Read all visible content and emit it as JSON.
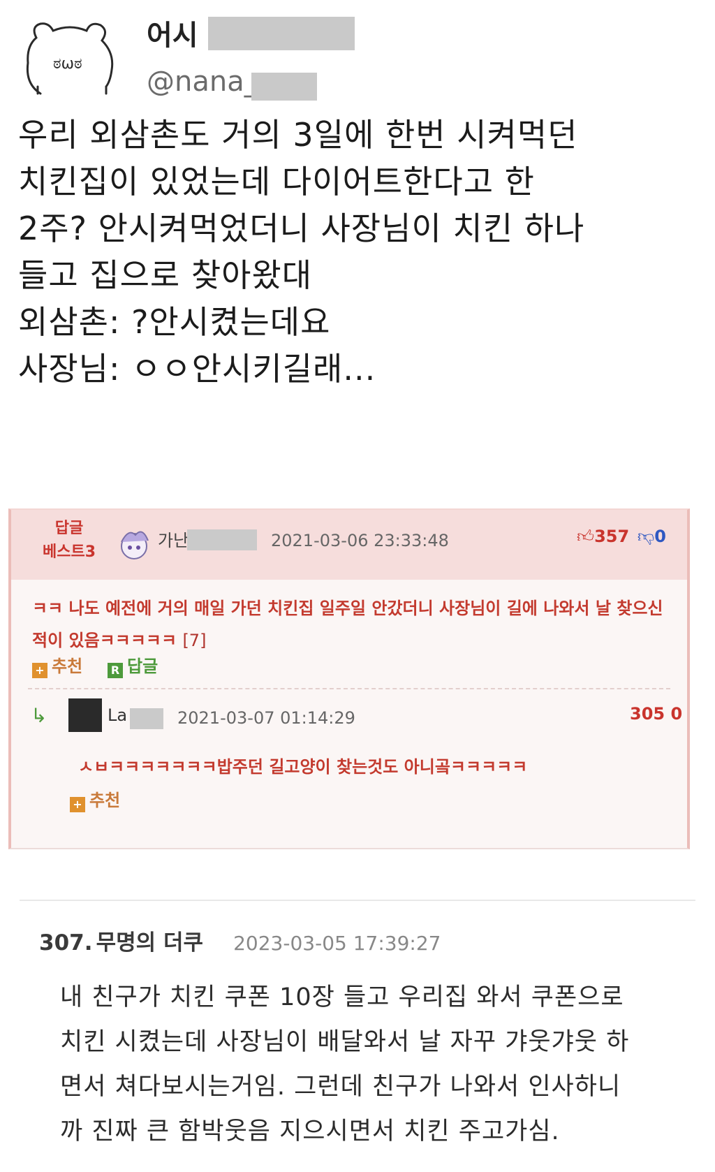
{
  "tweet": {
    "name_visible": "어시",
    "handle_visible": "@nana_",
    "lines": [
      "우리 외삼촌도 거의 3일에 한번 시켜먹던",
      "치킨집이 있었는데 다이어트한다고 한",
      "2주? 안시켜먹었더니 사장님이 치킨 하나",
      "들고 집으로 찾아왔대",
      "외삼촌: ?안시켰는데요",
      "사장님: ㅇㅇ안시키길래..."
    ]
  },
  "comment": {
    "badge_line1": "답글",
    "badge_line2": "베스트3",
    "user_visible": "가난",
    "date": "2021-03-06 23:33:48",
    "upvotes": "357",
    "downvotes": "0",
    "body": "ㅋㅋ 나도 예전에 거의 매일 가던 치킨집 일주일 안갔더니 사장님이 길에 나와서 날 찾으신적이 있음ㅋㅋㅋㅋㅋ",
    "reply_count": "[7]",
    "recommend_label": "추천",
    "reply_label": "답글",
    "reply": {
      "user_visible": "La",
      "date": "2021-03-07 01:14:29",
      "votes": "305 0",
      "body": "ㅅㅂㅋㅋㅋㅋㅋㅋㅋ밥주던 길고양이 찾는것도 아니곸ㅋㅋㅋㅋㅋ",
      "recommend_label": "추천"
    }
  },
  "post": {
    "number": "307.",
    "author": "무명의 더쿠",
    "date": "2023-03-05 17:39:27",
    "lines": [
      "내 친구가 치킨 쿠폰 10장 들고 우리집 와서 쿠폰으로",
      "치킨 시켰는데 사장님이 배달와서 날 자꾸 갸웃갸웃 하",
      "면서 쳐다보시는거임. 그런데 친구가 나와서 인사하니",
      "까 진짜 큰 함박웃음 지으시면서 치킨 주고가심."
    ]
  },
  "colors": {
    "accent_red": "#c33a2e",
    "header_pink": "#f6dddc",
    "upvote_blue": "#2f58c2",
    "reply_green": "#4d9a3b",
    "recommend_orange": "#e0912e"
  }
}
